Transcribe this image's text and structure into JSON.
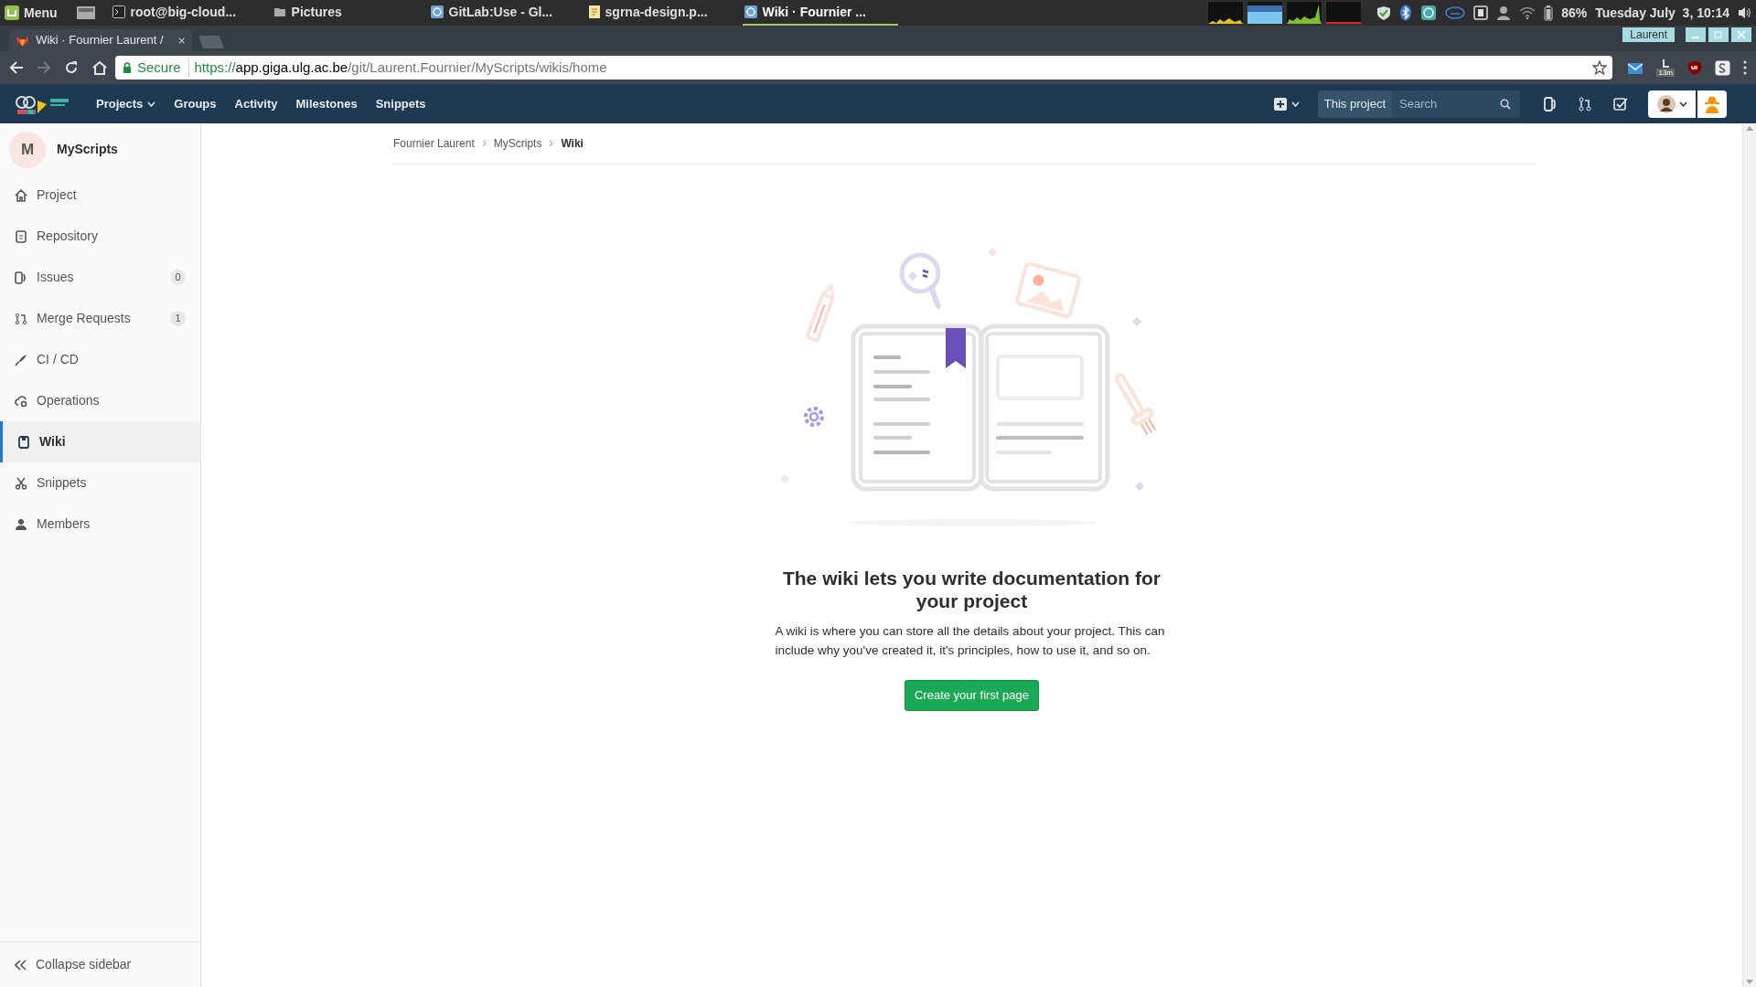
{
  "taskbar": {
    "menu": "Menu",
    "windows": [
      {
        "title": "root@big-cloud...",
        "selected": false
      },
      {
        "title": "Pictures",
        "selected": false
      },
      {
        "title": "GitLab:Use - Gl...",
        "selected": false
      },
      {
        "title": "sgrna-design.p...",
        "selected": false
      },
      {
        "title": "Wiki · Fournier ...",
        "selected": true
      }
    ],
    "battery": "86%",
    "clock": "Tuesday July  3, 10:14"
  },
  "browser": {
    "tab_title": "Wiki · Fournier Laurent /",
    "profile": "Laurent",
    "secure_label": "Secure",
    "url_scheme": "https://",
    "url_host": "app.giga.ulg.ac.be",
    "url_path": "/git/Laurent.Fournier/MyScripts/wikis/home",
    "extension_badge": "13m"
  },
  "nav": {
    "items": [
      {
        "label": "Projects",
        "dropdown": true
      },
      {
        "label": "Groups",
        "dropdown": false
      },
      {
        "label": "Activity",
        "dropdown": false
      },
      {
        "label": "Milestones",
        "dropdown": false
      },
      {
        "label": "Snippets",
        "dropdown": false
      }
    ],
    "search_scope": "This project",
    "search": {
      "placeholder": "Search"
    }
  },
  "sidebar": {
    "project_initial": "M",
    "project_name": "MyScripts",
    "items": [
      {
        "label": "Project",
        "selected": false
      },
      {
        "label": "Repository",
        "selected": false
      },
      {
        "label": "Issues",
        "count": "0",
        "selected": false
      },
      {
        "label": "Merge Requests",
        "count": "1",
        "selected": false
      },
      {
        "label": "CI / CD",
        "selected": false
      },
      {
        "label": "Operations",
        "selected": false
      },
      {
        "label": "Wiki",
        "selected": true
      },
      {
        "label": "Snippets",
        "selected": false
      },
      {
        "label": "Members",
        "selected": false
      }
    ],
    "collapse": "Collapse sidebar"
  },
  "breadcrumbs": [
    "Fournier Laurent",
    "MyScripts",
    "Wiki"
  ],
  "empty_state": {
    "title": "The wiki lets you write documentation for your project",
    "text": "A wiki is where you can store all the details about your project. This can include why you've created it, it's principles, how to use it, and so on.",
    "button": "Create your first page"
  }
}
